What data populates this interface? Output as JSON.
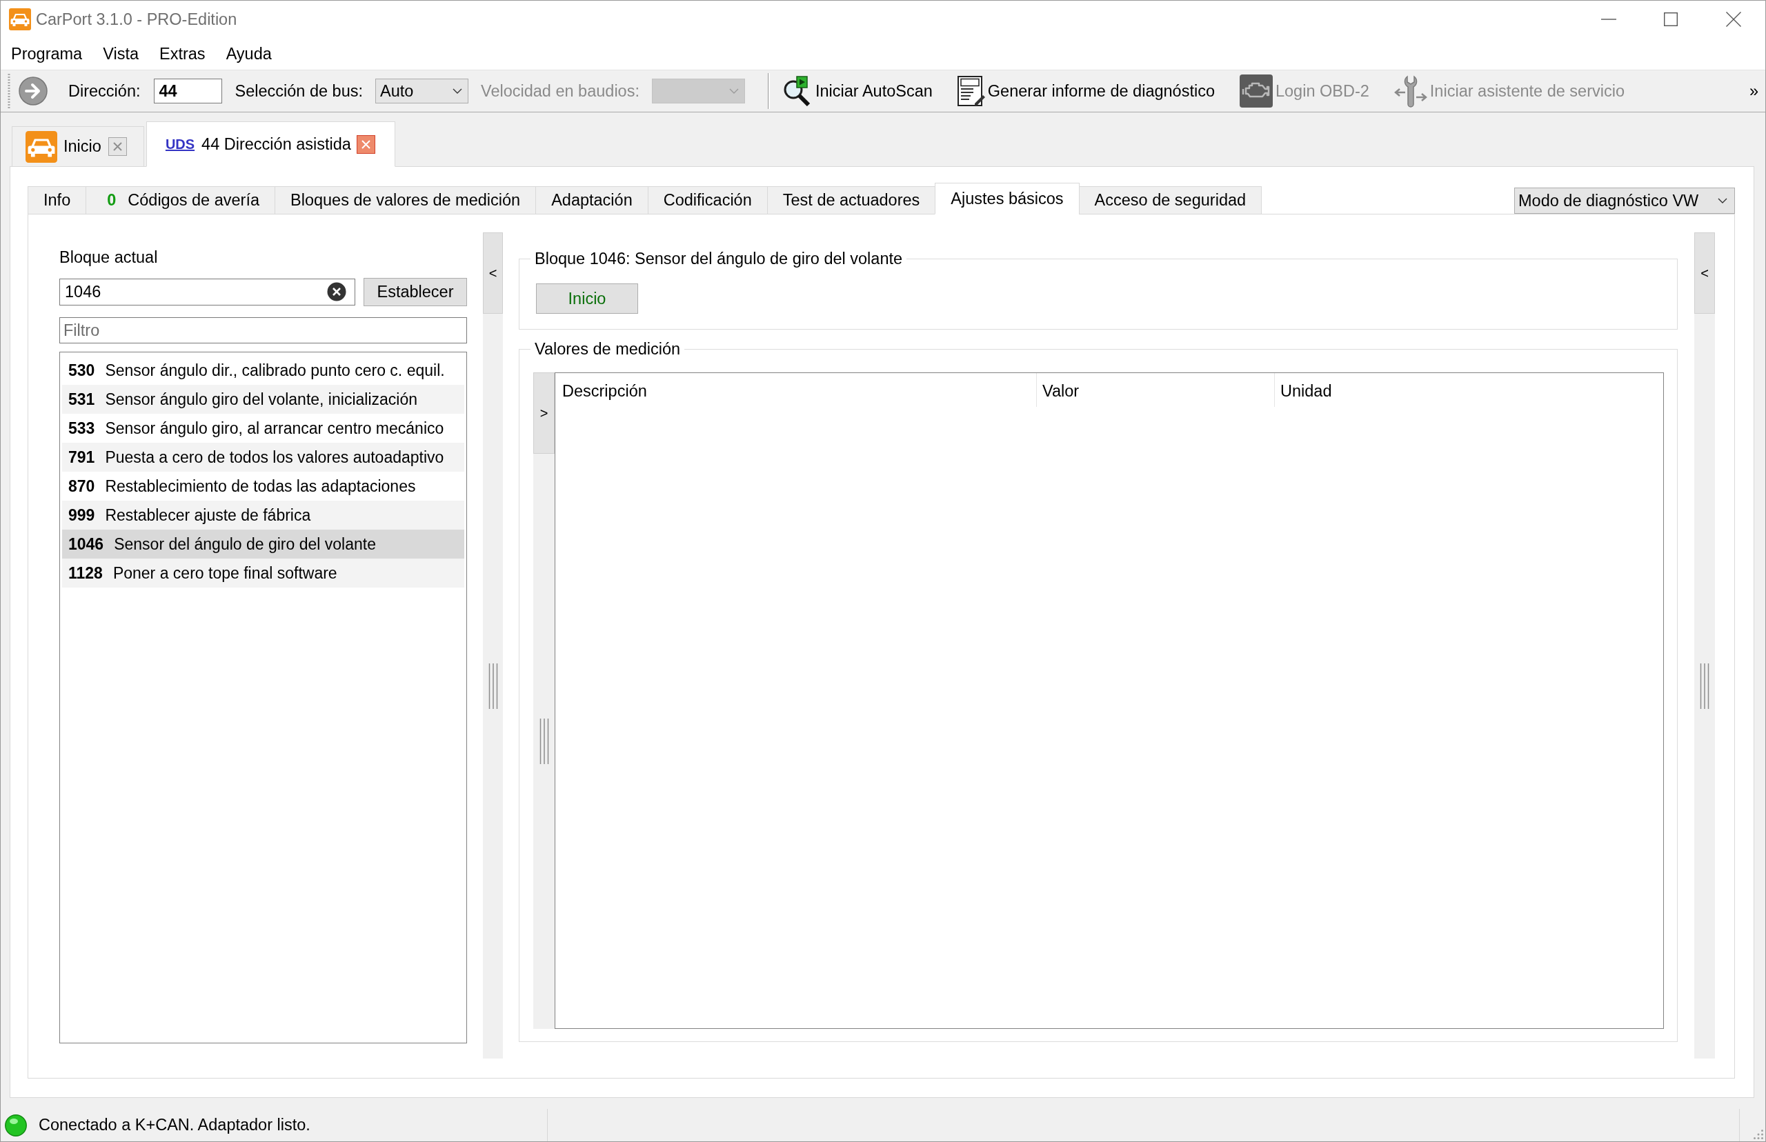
{
  "window": {
    "title": "CarPort 3.1.0 - PRO-Edition"
  },
  "menu": [
    "Programa",
    "Vista",
    "Extras",
    "Ayuda"
  ],
  "toolbar": {
    "address": {
      "label": "Dirección:",
      "value": "44"
    },
    "bus": {
      "label": "Selección de bus:",
      "value": "Auto"
    },
    "baud": {
      "label": "Velocidad en baudios:",
      "disabled": true
    },
    "buttons": [
      {
        "label": "Iniciar AutoScan",
        "disabled": false
      },
      {
        "label": "Generar informe de diagnóstico",
        "disabled": false
      },
      {
        "label": "Login OBD-2",
        "disabled": true
      },
      {
        "label": "Iniciar asistente de servicio",
        "disabled": true
      }
    ],
    "overflow": "»"
  },
  "doc_tabs": [
    {
      "kind": "home",
      "label": "Inicio",
      "selected": false
    },
    {
      "kind": "module",
      "protocol": "UDS",
      "label": "44 Dirección asistida",
      "selected": true
    }
  ],
  "tabs": [
    {
      "label": "Info",
      "selected": false
    },
    {
      "count": "0",
      "label": "Códigos de avería",
      "selected": false
    },
    {
      "label": "Bloques de valores de medición",
      "selected": false
    },
    {
      "label": "Adaptación",
      "selected": false
    },
    {
      "label": "Codificación",
      "selected": false
    },
    {
      "label": "Test de actuadores",
      "selected": false
    },
    {
      "label": "Ajustes básicos",
      "selected": true
    },
    {
      "label": "Acceso de seguridad",
      "selected": false
    }
  ],
  "mode_select": {
    "value": "Modo de diagnóstico VW"
  },
  "current_block": {
    "label": "Bloque actual",
    "value": "1046",
    "button": "Establecer"
  },
  "filter": {
    "placeholder": "Filtro"
  },
  "blocks": [
    {
      "number": "530",
      "name": "Sensor ángulo dir., calibrado punto cero c. equil.",
      "selected": false
    },
    {
      "number": "531",
      "name": "Sensor ángulo giro del volante, inicialización",
      "selected": false
    },
    {
      "number": "533",
      "name": "Sensor ángulo giro, al arrancar centro mecánico",
      "selected": false
    },
    {
      "number": "791",
      "name": "Puesta a cero de todos los valores autoadaptivo",
      "selected": false
    },
    {
      "number": "870",
      "name": "Restablecimiento de todas las adaptaciones",
      "selected": false
    },
    {
      "number": "999",
      "name": "Restablecer ajuste de fábrica",
      "selected": false
    },
    {
      "number": "1046",
      "name": "Sensor del ángulo de giro del volante",
      "selected": true
    },
    {
      "number": "1128",
      "name": "Poner a cero tope final software",
      "selected": false
    }
  ],
  "left_splitter": {
    "button": "<"
  },
  "block_group": {
    "title": "Bloque 1046: Sensor del ángulo de giro del volante",
    "button": "Inicio"
  },
  "measurements": {
    "title": "Valores de medición",
    "side_button": ">",
    "columns": [
      "Descripción",
      "Valor",
      "Unidad"
    ]
  },
  "right_splitter": {
    "button": "<"
  },
  "status_bar": {
    "connected": true,
    "text": "Conectado a K+CAN. Adaptador listo."
  }
}
